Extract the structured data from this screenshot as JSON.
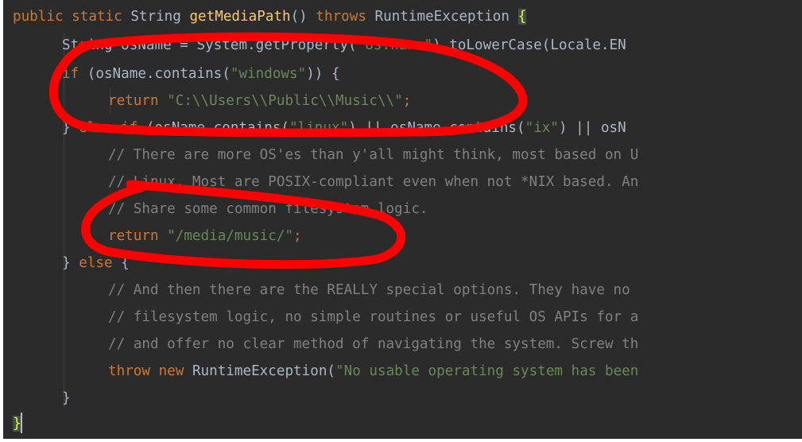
{
  "code": {
    "line1": {
      "mod1": "public",
      "mod2": "static",
      "type": "String",
      "name": "getMediaPath",
      "parens": "()",
      "throws_kw": "throws",
      "exception": "RuntimeException",
      "open_brace": "{"
    },
    "line2": {
      "prefix": "String osName = System.getProperty(",
      "arg": "\"os.name\"",
      "suffix": ").toLowerCase(Locale.EN"
    },
    "line3": {
      "kw": "if",
      "pre": " (osName.contains(",
      "arg": "\"windows\"",
      "post": ")) {"
    },
    "line4": {
      "kw": "return",
      "value": "\"C:\\\\Users\\\\Public\\\\Music\\\\\"",
      "semi": ";"
    },
    "line5": {
      "close": "} ",
      "else_kw": "else",
      "sp": " ",
      "if_kw": "if",
      "pre": " (osName.contains(",
      "arg1": "\"linux\"",
      "mid": ") || osName.contains(",
      "arg2": "\"ix\"",
      "post": ") || osN"
    },
    "comment1": "// There are more OS'es than y'all might think, most based on U",
    "comment2": "// Linux. Most are POSIX-compliant even when not *NIX based. An",
    "comment3": "// Share some common filesystem logic.",
    "line9": {
      "kw": "return",
      "value": "\"/media/music/\"",
      "semi": ";"
    },
    "line10": {
      "close": "} ",
      "else_kw": "else",
      "open": " {"
    },
    "comment4": "// And then there are the REALLY special options. They have no",
    "comment5": "// filesystem logic, no simple routines or useful OS APIs for a",
    "comment6": "// and offer no clear method of navigating the system. Screw th",
    "line14": {
      "throw_kw": "throw",
      "new_kw": "new",
      "exception": "RuntimeException(",
      "message": "\"No usable operating system has been"
    },
    "line15": "}",
    "line16": "}"
  },
  "colors": {
    "background": "#2b2b2b",
    "keyword": "#cc7832",
    "method": "#ffc66d",
    "string": "#6a8759",
    "comment": "#808080",
    "default_text": "#a9b7c6",
    "annotation": "#ff0000"
  }
}
